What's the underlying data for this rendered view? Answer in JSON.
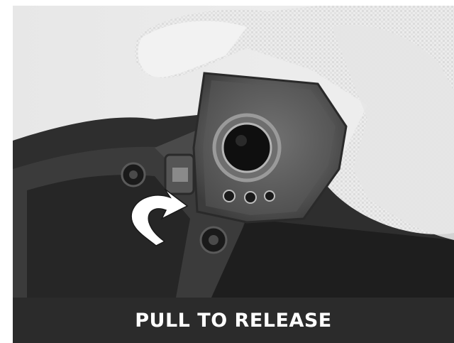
{
  "caption": {
    "text": "PULL TO RELEASE"
  },
  "photo": {
    "icons": [
      "curved-arrow-icon"
    ]
  },
  "colors": {
    "caption_bg": "#2b2b2b",
    "caption_text": "#ffffff"
  }
}
